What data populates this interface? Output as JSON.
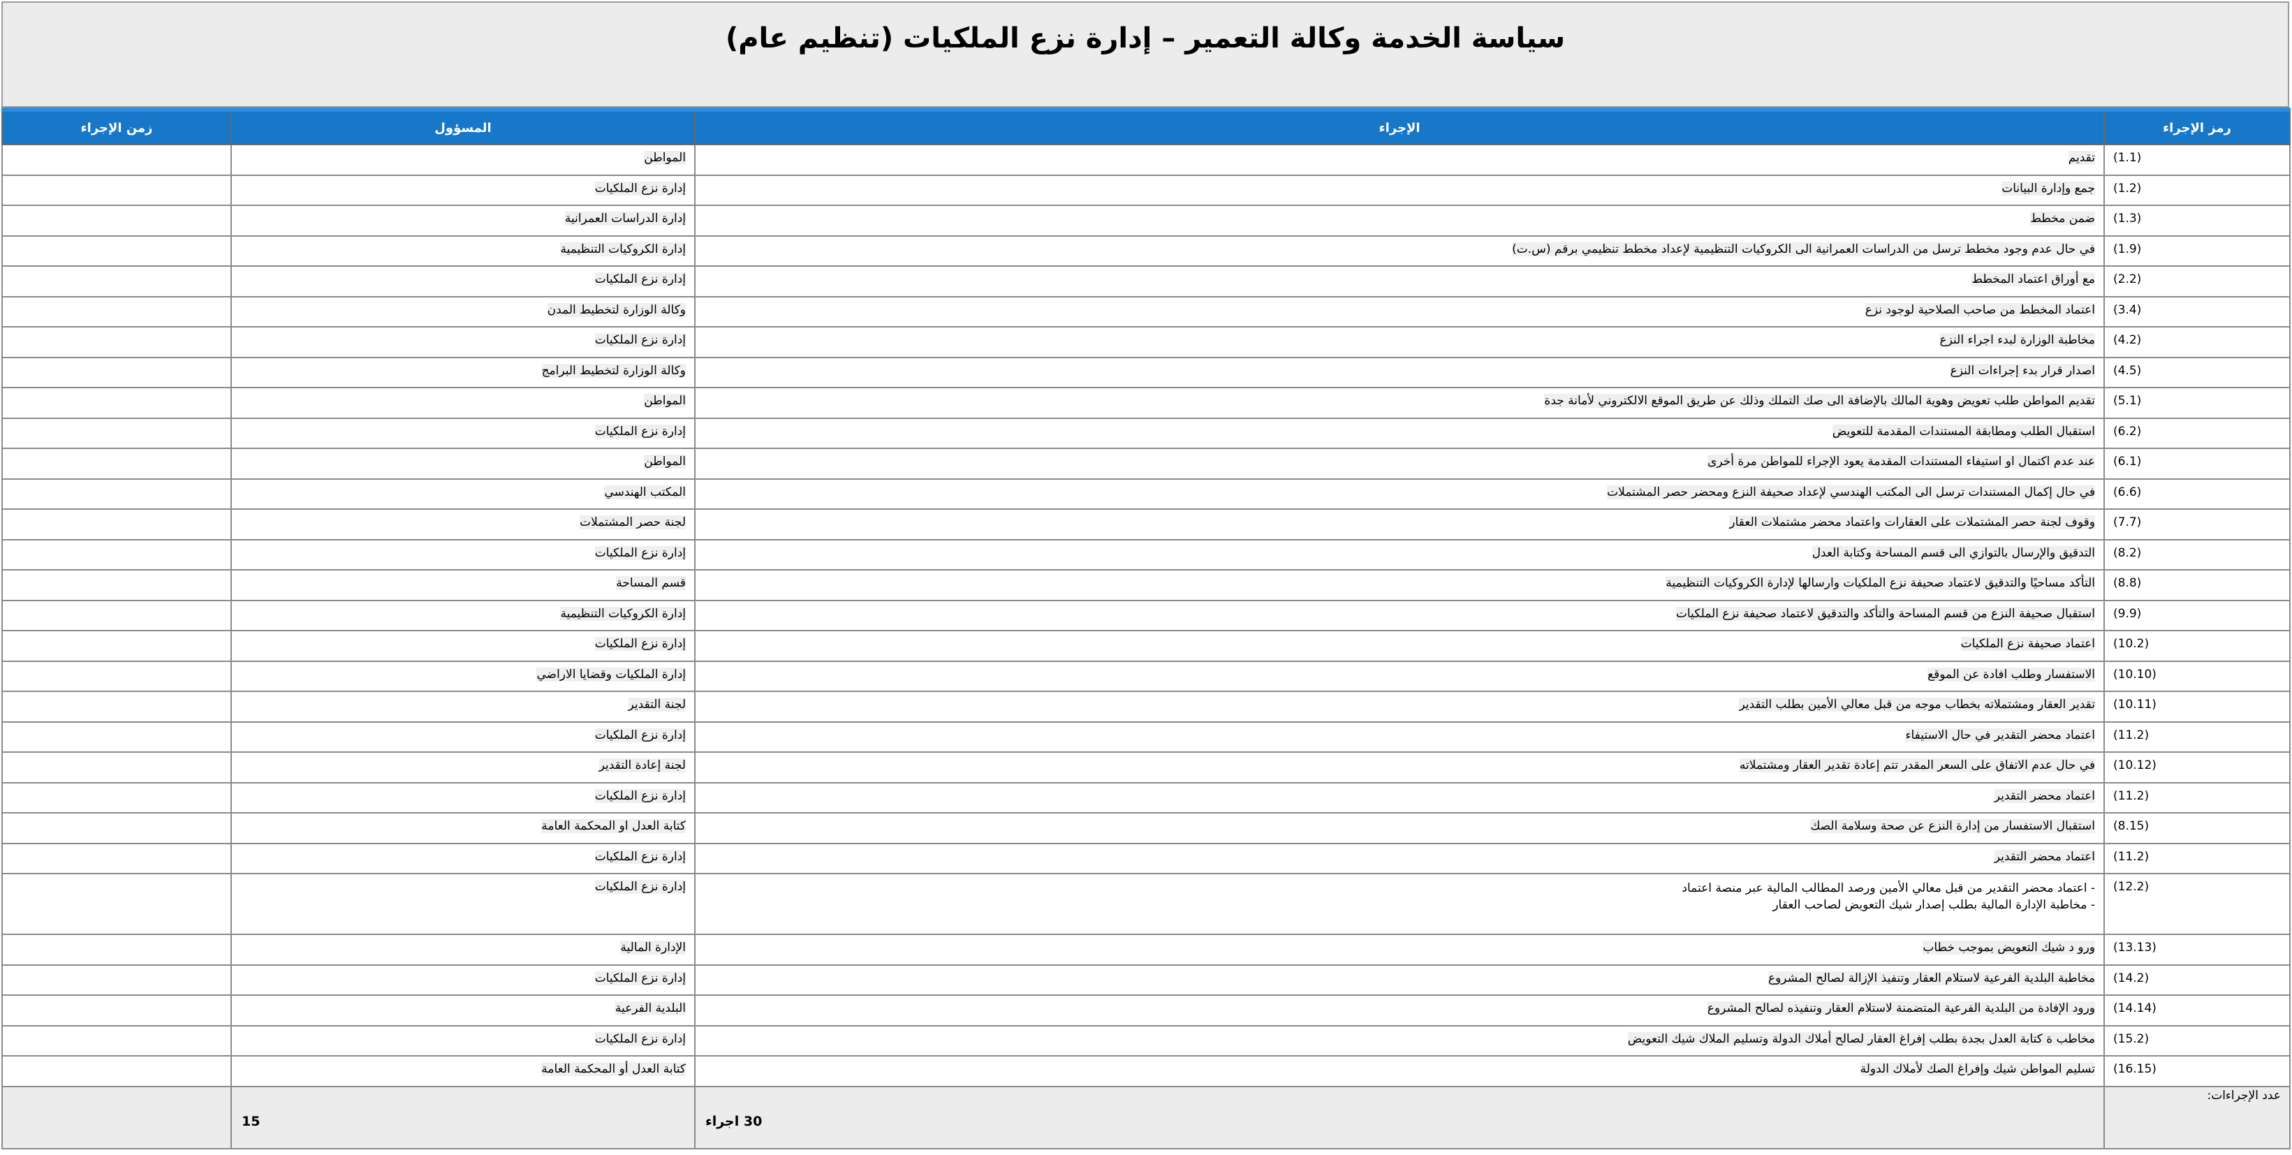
{
  "title": "سياسة الخدمة وكالة التعمير – إدارة نزع الملكيات (تنظيم عام)",
  "headers": {
    "code": "رمز الإجراء",
    "procedure": "الإجراء",
    "responsible": "المسؤول",
    "time": "زمن الإجراء"
  },
  "rows": [
    {
      "code": "(1.1)",
      "procedure": "تقديم",
      "responsible": "المواطن",
      "time": ""
    },
    {
      "code": "(1.2)",
      "procedure": "جمع وإدارة البيانات",
      "responsible": "إدارة نزع الملكيات",
      "time": ""
    },
    {
      "code": "(1.3)",
      "procedure": "ضمن مخطط",
      "responsible": "إدارة الدراسات العمرانية",
      "time": ""
    },
    {
      "code": "(1.9)",
      "procedure": "في حال عدم وجود مخطط ترسل من الدراسات العمرانية الى الكروكيات التنظيمية لإعداد مخطط تنظيمي برقم (س.ت)",
      "responsible": "إدارة الكروكيات التنظيمية",
      "time": ""
    },
    {
      "code": "(2.2)",
      "procedure": "مع أوراق اعتماد المخطط",
      "responsible": "إدارة نزع الملكيات",
      "time": ""
    },
    {
      "code": "(3.4)",
      "procedure": "اعتماد المخطط من صاحب الصلاحية لوجود نزع",
      "responsible": "وكالة الوزارة لتخطيط المدن",
      "time": ""
    },
    {
      "code": "(4.2)",
      "procedure": "مخاطبة الوزارة لبدء اجراء النزع",
      "responsible": "إدارة نزع الملكيات",
      "time": ""
    },
    {
      "code": "(4.5)",
      "procedure": "اصدار قرار بدء إجراءات النزع",
      "responsible": "وكالة الوزارة لتخطيط البرامج",
      "time": ""
    },
    {
      "code": "(5.1)",
      "procedure": "تقديم المواطن طلب تعويض وهوية المالك بالإضافة الى صك التملك وذلك عن طريق الموقع الالكتروني لأمانة جدة",
      "responsible": "المواطن",
      "time": ""
    },
    {
      "code": "(6.2)",
      "procedure": "استقبال الطلب ومطابقة المستندات المقدمة للتعويض",
      "responsible": "إدارة نزع الملكيات",
      "time": ""
    },
    {
      "code": "(6.1)",
      "procedure": "عند عدم اكتمال او استيفاء المستندات المقدمة يعود الإجراء للمواطن مرة أخرى",
      "responsible": "المواطن",
      "time": ""
    },
    {
      "code": "(6.6)",
      "procedure": "في حال إكمال المستندات ترسل الى المكتب الهندسي لإعداد صحيفة النزع ومحضر حصر المشتملات",
      "responsible": "المكتب الهندسي",
      "time": ""
    },
    {
      "code": "(7.7)",
      "procedure": "وقوف لجنة حصر المشتملات على العقارات واعتماد محضر مشتملات العقار",
      "responsible": "لجنة حصر المشتملات",
      "time": ""
    },
    {
      "code": "(8.2)",
      "procedure": "التدقيق والإرسال بالتوازي الى قسم المساحة وكتابة العدل",
      "responsible": "إدارة نزع الملكيات",
      "time": ""
    },
    {
      "code": "(8.8)",
      "procedure": "التأكد مساحيًا والتدقيق لاعتماد صحيفة نزع الملكيات وارسالها لإدارة الكروكيات التنظيمية",
      "responsible": "قسم المساحة",
      "time": ""
    },
    {
      "code": "(9.9)",
      "procedure": "استقبال صحيفة النزع من قسم المساحة والتأكد والتدقيق لاعتماد صحيفة نزع الملكيات",
      "responsible": "إدارة الكروكيات التنظيمية",
      "time": ""
    },
    {
      "code": "(10.2)",
      "procedure": "اعتماد صحيفة نزع الملكيات",
      "responsible": "إدارة نزع الملكيات",
      "time": ""
    },
    {
      "code": "(10.10)",
      "procedure": "الاستفسار وطلب افادة عن الموقع",
      "responsible": "إدارة الملكيات وقضايا الاراضي",
      "time": ""
    },
    {
      "code": "(10.11)",
      "procedure": "تقدير العقار ومشتملاته بخطاب موجه من قبل معالي الأمين بطلب التقدير",
      "responsible": "لجنة التقدير",
      "time": ""
    },
    {
      "code": "(11.2)",
      "procedure": "اعتماد محضر التقدير في حال الاستيفاء",
      "responsible": "إدارة نزع الملكيات",
      "time": ""
    },
    {
      "code": "(10.12)",
      "procedure": "في حال عدم الاتفاق على السعر المقدر تتم إعادة تقدير العقار ومشتملاته",
      "responsible": "لجنة إعادة التقدير",
      "time": ""
    },
    {
      "code": "(11.2)",
      "procedure": "اعتماد محضر التقدير",
      "responsible": "إدارة نزع الملكيات",
      "time": ""
    },
    {
      "code": "(8.15)",
      "procedure": "استقبال الاستفسار من إدارة النزع عن صحة وسلامة الصك",
      "responsible": "كتابة العدل او المحكمة العامة",
      "time": ""
    },
    {
      "code": "(11.2)",
      "procedure": "اعتماد محضر التقدير",
      "responsible": "إدارة نزع الملكيات",
      "time": ""
    },
    {
      "code": "(12.2)",
      "procedure_lines": [
        "- اعتماد محضر التقدير من قبل معالي الأمين ورصد المطالب المالية عبر منصة اعتماد",
        "- مخاطبة الإدارة المالية بطلب إصدار شيك التعويض لصاحب العقار"
      ],
      "responsible": "إدارة نزع الملكيات",
      "time": "",
      "tall": true
    },
    {
      "code": "(13.13)",
      "procedure": "ورو د شيك التعويض بموجب خطاب",
      "responsible": "الإدارة المالية",
      "time": ""
    },
    {
      "code": "(14.2)",
      "procedure": "مخاطبة البلدية الفرعية لاستلام العقار وتنفيذ الإزالة لصالح المشروع",
      "responsible": "إدارة نزع الملكيات",
      "time": ""
    },
    {
      "code": "(14.14)",
      "procedure": "ورود الإفادة من البلدية الفرعية المتضمنة لاستلام العقار وتنفيذه لصالح المشروع",
      "responsible": "البلدية الفرعية",
      "time": ""
    },
    {
      "code": "(15.2)",
      "procedure": "مخاطب ة كتابة العدل بجدة بطلب إفراغ العقار لصالح أملاك الدولة وتسليم الملاك شيك التعويض",
      "responsible": "إدارة نزع الملكيات",
      "time": ""
    },
    {
      "code": "(16.15)",
      "procedure": "تسليم المواطن شيك وإفراغ الصك لأملاك الدولة",
      "responsible": "كتابة العدل أو المحكمة العامة",
      "time": ""
    }
  ],
  "footer": {
    "count_label": "عدد الإجراءات:",
    "procedures_total": "30 اجراء",
    "responsible_total": "15",
    "time_total": ""
  }
}
